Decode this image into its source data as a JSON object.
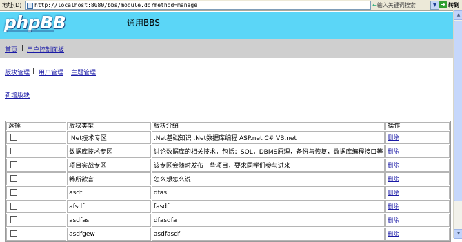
{
  "browser": {
    "address_label": "地址(D)",
    "url": "http://localhost:8080/bbs/module.do?method=manage",
    "keyword_placeholder": "输入关键词搜索",
    "go_label": "转到"
  },
  "header": {
    "logo_text": "phpBB",
    "site_title": "通用BBS"
  },
  "top_nav": [
    "首页",
    "用户控制面板"
  ],
  "sub_nav": [
    "版块管理",
    "用户管理",
    "主题管理"
  ],
  "new_board_link": "新增版块",
  "table": {
    "headers": [
      "选择",
      "版块类型",
      "版块介绍",
      "操作"
    ],
    "delete_label": "删除",
    "rows": [
      {
        "type": ".Net技术专区",
        "intro": ".Net基础知识 .Net数据库编程 ASP.net C# VB.net"
      },
      {
        "type": "数据库技术专区",
        "intro": "讨论数据库的相关技术，包括：SQL，DBMS原理，备份与恢复，数据库编程接口等"
      },
      {
        "type": "项目实战专区",
        "intro": "该专区会随时发布一些项目，要求同学们参与进来"
      },
      {
        "type": "畅所欲言",
        "intro": "怎么想怎么说"
      },
      {
        "type": "asdf",
        "intro": "dfas"
      },
      {
        "type": "afsdf",
        "intro": "fasdf"
      },
      {
        "type": "asdfas",
        "intro": "dfasdfa"
      },
      {
        "type": "asdfgew",
        "intro": "asdfasdf"
      }
    ]
  }
}
